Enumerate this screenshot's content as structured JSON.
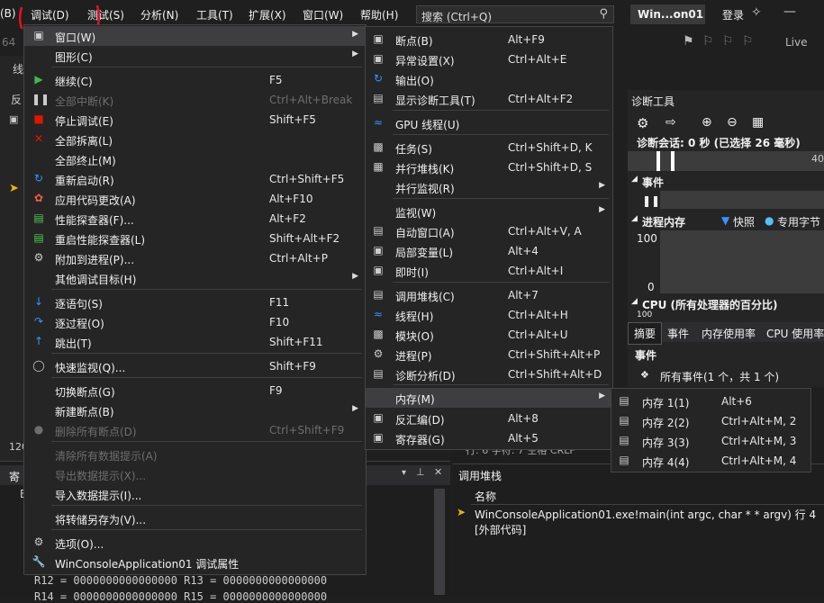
{
  "menubar": {
    "left_cut": "(B)",
    "items": [
      "调试(D)",
      "测试(S)",
      "分析(N)",
      "工具(T)",
      "扩展(X)",
      "窗口(W)",
      "帮助(H)"
    ],
    "search_placeholder": "搜索 (Ctrl+Q)",
    "app_title": "Win...on01",
    "login": "登录",
    "live_share": "Live"
  },
  "background": {
    "toolbar_num": "64",
    "side_labels": [
      "线",
      "反",
      "120"
    ],
    "reg_header": "寄",
    "reg_lines": [
      "R12 = 0000000000000000 R13 = 0000000000000000",
      "R14 = 0000000000000000 R15 = 0000000000000000"
    ],
    "reg_letter": "E",
    "stack_tabs": "行: 6    字符: 7    空格    CRLF"
  },
  "debug_menu": {
    "items": [
      {
        "icon": "window-icon",
        "label": "窗口(W)",
        "shortcut": "",
        "arrow": true,
        "disabled": false,
        "highlight": true
      },
      {
        "icon": "",
        "label": "图形(C)",
        "shortcut": "",
        "arrow": true,
        "disabled": false
      },
      {
        "icon": "play-icon",
        "label": "继续(C)",
        "shortcut": "F5",
        "disabled": false
      },
      {
        "icon": "pause-icon",
        "label": "全部中断(K)",
        "shortcut": "Ctrl+Alt+Break",
        "disabled": true
      },
      {
        "icon": "stop-icon",
        "label": "停止调试(E)",
        "shortcut": "Shift+F5",
        "disabled": false
      },
      {
        "icon": "detach-icon",
        "label": "全部拆离(L)",
        "shortcut": "",
        "disabled": false
      },
      {
        "icon": "",
        "label": "全部终止(M)",
        "shortcut": "",
        "disabled": false
      },
      {
        "icon": "restart-icon",
        "label": "重新启动(R)",
        "shortcut": "Ctrl+Shift+F5",
        "disabled": false
      },
      {
        "icon": "hot-reload-icon",
        "label": "应用代码更改(A)",
        "shortcut": "Alt+F10",
        "disabled": false
      },
      {
        "icon": "profiler-icon",
        "label": "性能探查器(F)...",
        "shortcut": "Alt+F2",
        "disabled": false
      },
      {
        "icon": "profiler-restart-icon",
        "label": "重启性能探查器(L)",
        "shortcut": "Shift+Alt+F2",
        "disabled": false
      },
      {
        "icon": "attach-icon",
        "label": "附加到进程(P)...",
        "shortcut": "Ctrl+Alt+P",
        "disabled": false
      },
      {
        "icon": "",
        "label": "其他调试目标(H)",
        "shortcut": "",
        "arrow": true,
        "disabled": false
      },
      {
        "icon": "step-into-icon",
        "label": "逐语句(S)",
        "shortcut": "F11",
        "disabled": false
      },
      {
        "icon": "step-over-icon",
        "label": "逐过程(O)",
        "shortcut": "F10",
        "disabled": false
      },
      {
        "icon": "step-out-icon",
        "label": "跳出(T)",
        "shortcut": "Shift+F11",
        "disabled": false
      },
      {
        "icon": "quickwatch-icon",
        "label": "快速监视(Q)...",
        "shortcut": "Shift+F9",
        "disabled": false
      },
      {
        "icon": "",
        "label": "切换断点(G)",
        "shortcut": "F9",
        "disabled": false
      },
      {
        "icon": "",
        "label": "新建断点(B)",
        "shortcut": "",
        "arrow": true,
        "disabled": false
      },
      {
        "icon": "delete-breakpoints-icon",
        "label": "删除所有断点(D)",
        "shortcut": "Ctrl+Shift+F9",
        "disabled": true
      },
      {
        "icon": "",
        "label": "清除所有数据提示(A)",
        "shortcut": "",
        "disabled": true
      },
      {
        "icon": "",
        "label": "导出数据提示(X)...",
        "shortcut": "",
        "disabled": true
      },
      {
        "icon": "",
        "label": "导入数据提示(I)...",
        "shortcut": "",
        "disabled": false
      },
      {
        "icon": "",
        "label": "将转储另存为(V)...",
        "shortcut": "",
        "disabled": false
      },
      {
        "icon": "gear-icon",
        "label": "选项(O)...",
        "shortcut": "",
        "disabled": false
      },
      {
        "icon": "wrench-icon",
        "label": "WinConsoleApplication01 调试属性",
        "shortcut": "",
        "disabled": false
      }
    ]
  },
  "window_menu": {
    "items": [
      {
        "icon": "breakpoints-icon",
        "label": "断点(B)",
        "shortcut": "Alt+F9"
      },
      {
        "icon": "exception-icon",
        "label": "异常设置(X)",
        "shortcut": "Ctrl+Alt+E"
      },
      {
        "icon": "output-icon",
        "label": "输出(O)",
        "shortcut": ""
      },
      {
        "icon": "diag-tools-icon",
        "label": "显示诊断工具(T)",
        "shortcut": "Ctrl+Alt+F2"
      },
      {
        "icon": "gpu-threads-icon",
        "label": "GPU 线程(U)",
        "shortcut": ""
      },
      {
        "icon": "tasks-icon",
        "label": "任务(S)",
        "shortcut": "Ctrl+Shift+D, K"
      },
      {
        "icon": "parallel-stacks-icon",
        "label": "并行堆栈(K)",
        "shortcut": "Ctrl+Shift+D, S"
      },
      {
        "icon": "",
        "label": "并行监视(R)",
        "shortcut": "",
        "arrow": true
      },
      {
        "icon": "",
        "label": "监视(W)",
        "shortcut": "",
        "arrow": true
      },
      {
        "icon": "autos-icon",
        "label": "自动窗口(A)",
        "shortcut": "Ctrl+Alt+V, A"
      },
      {
        "icon": "locals-icon",
        "label": "局部变量(L)",
        "shortcut": "Alt+4"
      },
      {
        "icon": "immediate-icon",
        "label": "即时(I)",
        "shortcut": "Ctrl+Alt+I"
      },
      {
        "icon": "callstack-icon",
        "label": "调用堆栈(C)",
        "shortcut": "Alt+7"
      },
      {
        "icon": "threads-icon",
        "label": "线程(H)",
        "shortcut": "Ctrl+Alt+H"
      },
      {
        "icon": "modules-icon",
        "label": "模块(O)",
        "shortcut": "Ctrl+Alt+U"
      },
      {
        "icon": "processes-icon",
        "label": "进程(P)",
        "shortcut": "Ctrl+Shift+Alt+P"
      },
      {
        "icon": "diag-analysis-icon",
        "label": "诊断分析(D)",
        "shortcut": "Ctrl+Shift+Alt+D"
      },
      {
        "icon": "",
        "label": "内存(M)",
        "shortcut": "",
        "arrow": true,
        "highlight": true
      },
      {
        "icon": "disassembly-icon",
        "label": "反汇编(D)",
        "shortcut": "Alt+8"
      },
      {
        "icon": "registers-icon",
        "label": "寄存器(G)",
        "shortcut": "Alt+5"
      }
    ]
  },
  "memory_menu": {
    "items": [
      {
        "label": "内存 1(1)",
        "shortcut": "Alt+6"
      },
      {
        "label": "内存 2(2)",
        "shortcut": "Ctrl+Alt+M, 2"
      },
      {
        "label": "内存 3(3)",
        "shortcut": "Ctrl+Alt+M, 3"
      },
      {
        "label": "内存 4(4)",
        "shortcut": "Ctrl+Alt+M, 4"
      }
    ]
  },
  "diag_panel": {
    "title": "诊断工具",
    "session": "诊断会话: 0 秒 (已选择 26 毫秒)",
    "timeline_tick": "40",
    "events_label": "事件",
    "memory_label": "进程内存",
    "snapshot_label": "快照",
    "private_bytes_label": "专用字节",
    "mem_axis_top": "100",
    "mem_axis_bottom": "0",
    "cpu_label": "CPU (所有处理器的百分比)",
    "cpu_axis_top": "100",
    "tabs": [
      "摘要",
      "事件",
      "内存使用率",
      "CPU 使用率"
    ],
    "events_section": "事件",
    "all_events": "所有事件(1 个，共 1 个)"
  },
  "callstack_panel": {
    "title": "调用堆栈",
    "col_name": "名称",
    "rows": [
      "WinConsoleApplication01.exe!main(int argc, char * * argv) 行 4",
      "[外部代码]"
    ]
  },
  "colors": {
    "accent_blue": "#3794ff",
    "annotation_red": "#e81123",
    "menu_bg": "#252526"
  }
}
